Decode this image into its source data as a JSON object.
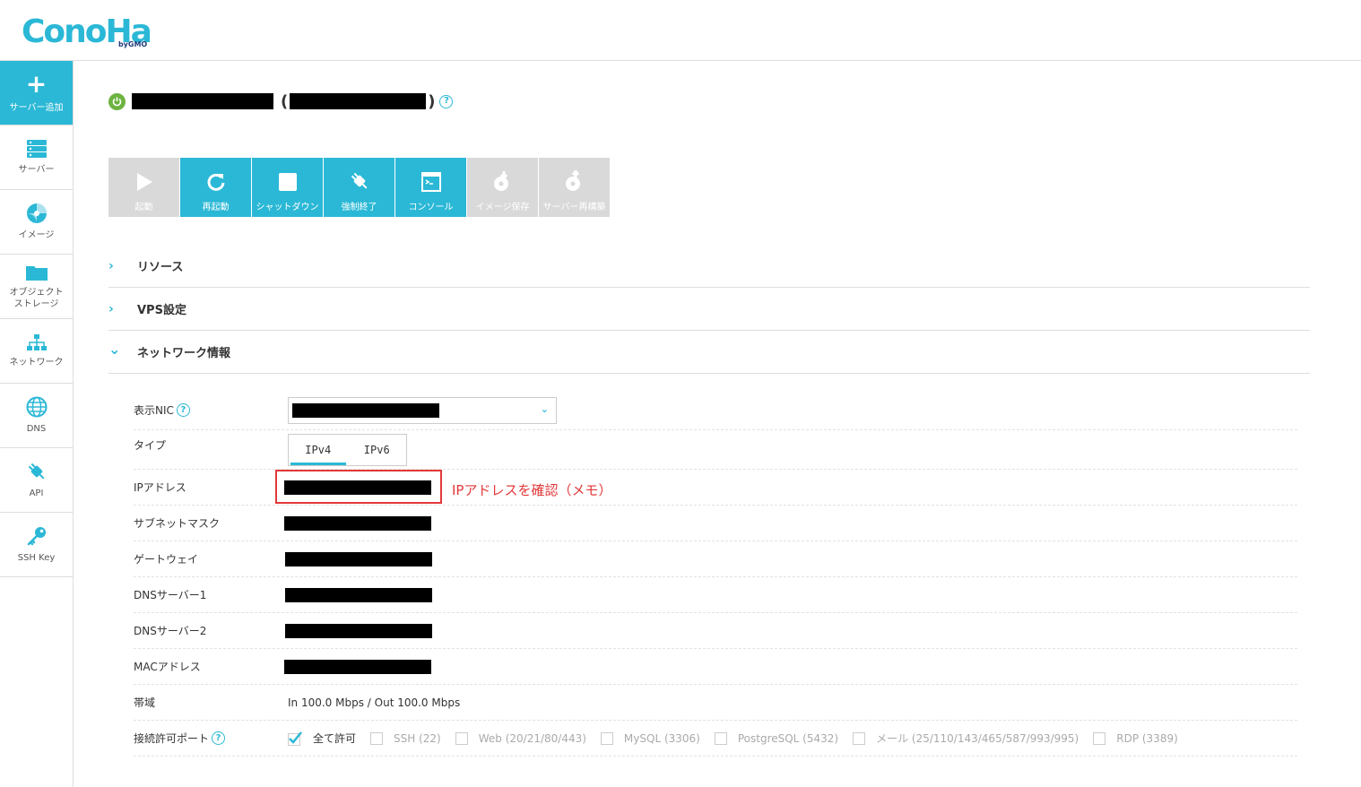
{
  "header": {
    "logo": "ConoHa",
    "logo_sub": "byGMO"
  },
  "sidebar": {
    "add_label": "サーバー追加",
    "items": [
      {
        "label": "サーバー"
      },
      {
        "label": "イメージ"
      },
      {
        "label": "オブジェクト\nストレージ"
      },
      {
        "label": "ネットワーク"
      },
      {
        "label": "DNS"
      },
      {
        "label": "API"
      },
      {
        "label": "SSH Key"
      }
    ]
  },
  "server": {
    "paren_open": "(",
    "paren_close": ")",
    "help": "?"
  },
  "toolbar": [
    {
      "label": "起動",
      "enabled": false
    },
    {
      "label": "再起動",
      "enabled": true
    },
    {
      "label": "シャットダウン",
      "enabled": true
    },
    {
      "label": "強制終了",
      "enabled": true
    },
    {
      "label": "コンソール",
      "enabled": true
    },
    {
      "label": "イメージ保存",
      "enabled": false
    },
    {
      "label": "サーバー再構築",
      "enabled": false
    }
  ],
  "sections": [
    {
      "title": "リソース",
      "chevron": "›"
    },
    {
      "title": "VPS設定",
      "chevron": "›"
    },
    {
      "title": "ネットワーク情報",
      "chevron": "⌄"
    }
  ],
  "network": {
    "nic_label": "表示NIC",
    "type_label": "タイプ",
    "tabs": [
      "IPv4",
      "IPv6"
    ],
    "active_tab": "IPv4",
    "ip_label": "IPアドレス",
    "subnet_label": "サブネットマスク",
    "gateway_label": "ゲートウェイ",
    "dns1_label": "DNSサーバー1",
    "dns2_label": "DNSサーバー2",
    "mac_label": "MACアドレス",
    "bandwidth_label": "帯域",
    "bandwidth_value": "In 100.0 Mbps / Out 100.0 Mbps",
    "ports_label": "接続許可ポート",
    "ports": [
      {
        "label": "全て許可",
        "checked": true
      },
      {
        "label": "SSH (22)",
        "checked": false
      },
      {
        "label": "Web (20/21/80/443)",
        "checked": false
      },
      {
        "label": "MySQL (3306)",
        "checked": false
      },
      {
        "label": "PostgreSQL (5432)",
        "checked": false
      },
      {
        "label": "メール (25/110/143/465/587/993/995)",
        "checked": false
      },
      {
        "label": "RDP (3389)",
        "checked": false
      }
    ]
  },
  "annotation": {
    "note": "IPアドレスを確認（メモ）",
    "color": "#e2383a"
  },
  "colors": {
    "accent": "#2bb8d6",
    "power": "#6cb33f",
    "disabled": "#d9d9d9"
  }
}
